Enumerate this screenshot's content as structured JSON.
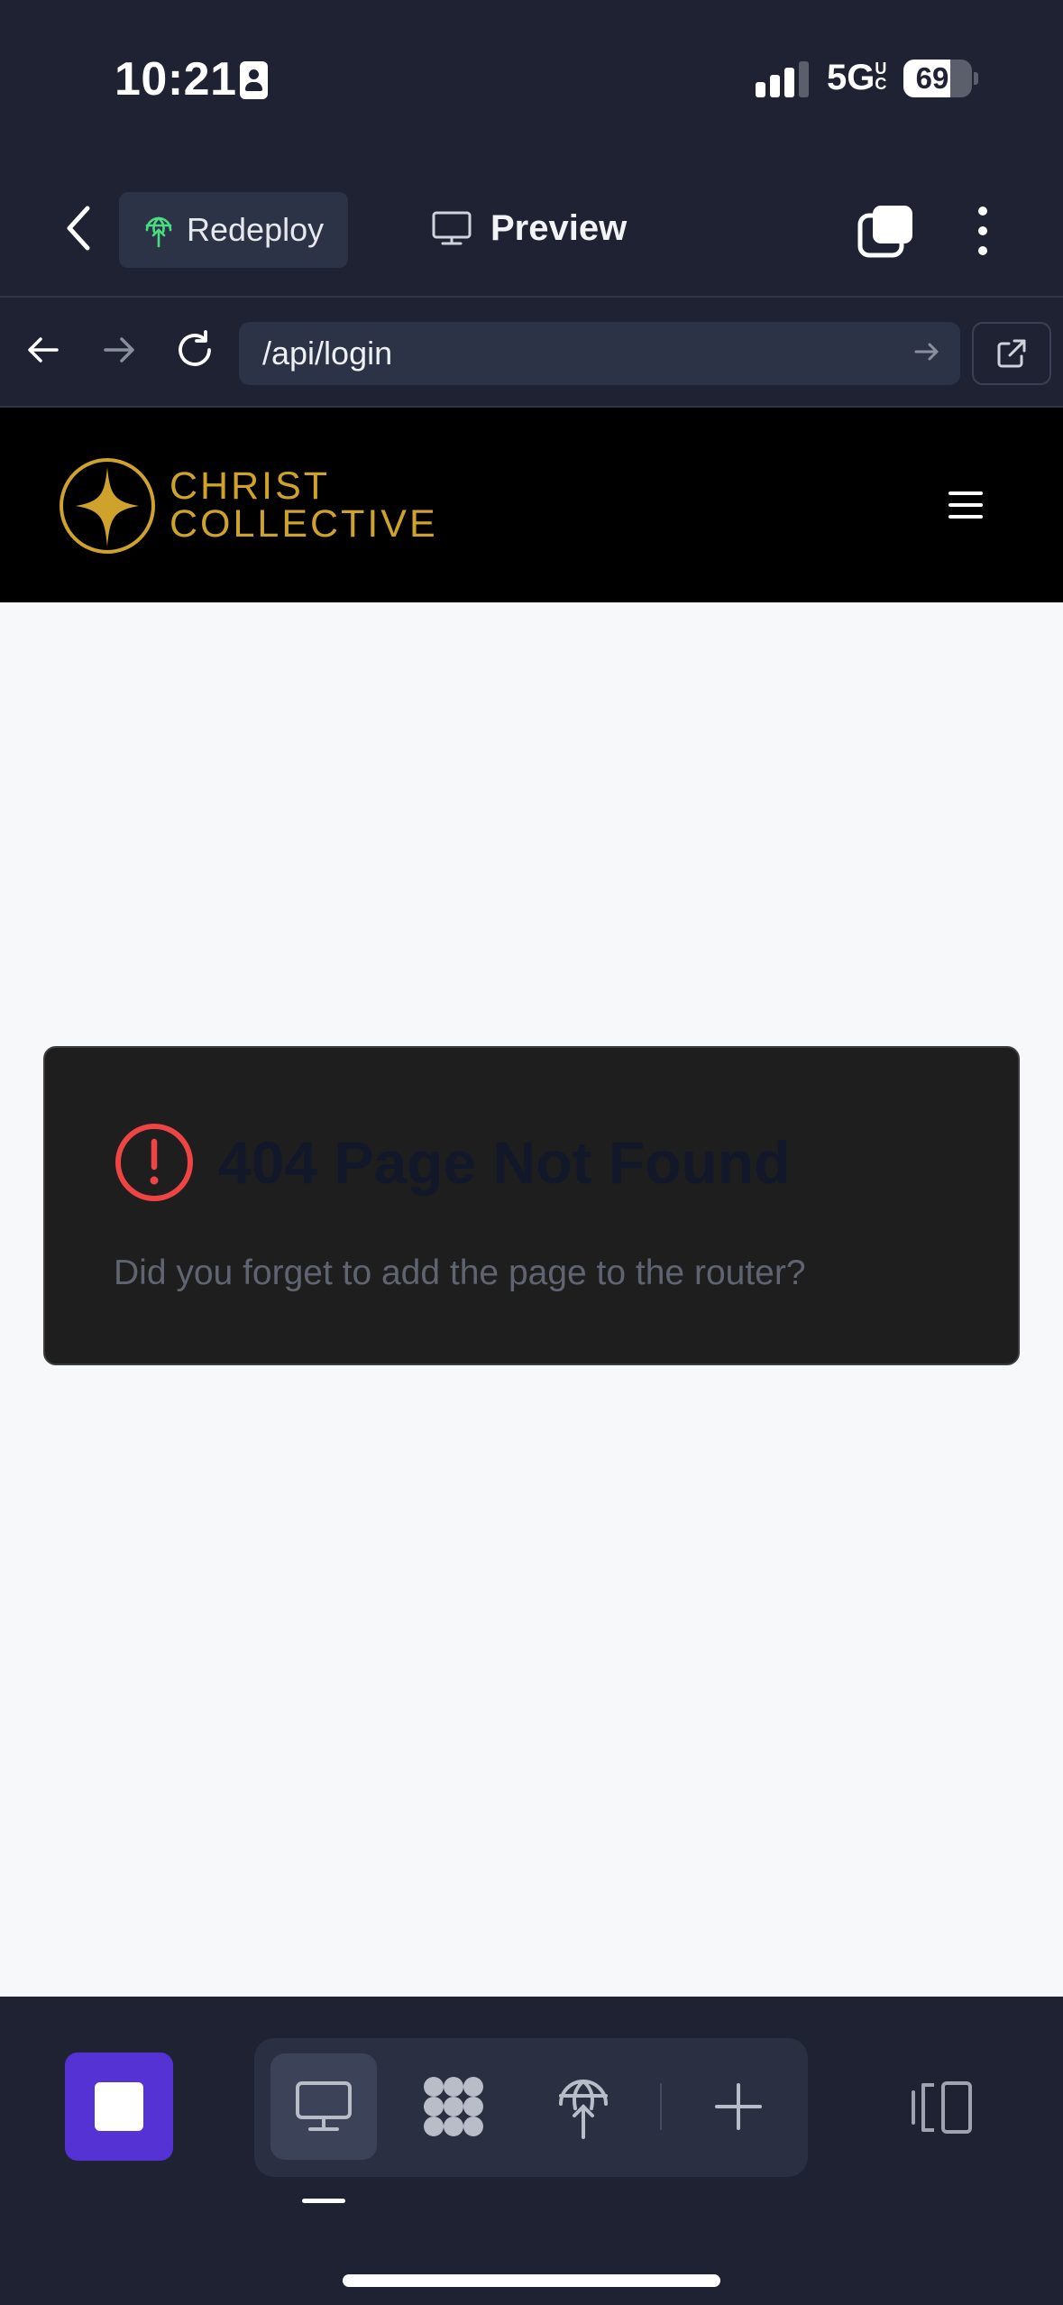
{
  "status_bar": {
    "time": "10:21",
    "network": "5G",
    "network_suffix_top": "U",
    "network_suffix_bottom": "C",
    "battery_percent": 69,
    "battery_text": "69"
  },
  "toolbar": {
    "back_icon": "chevron-left-icon",
    "redeploy_label": "Redeploy",
    "redeploy_icon": "globe-upload-icon",
    "redeploy_icon_color": "#4ade80",
    "preview_label": "Preview",
    "preview_icon": "monitor-icon",
    "tabs_icon": "stacked-squares-icon",
    "more_icon": "vertical-dots-icon"
  },
  "urlbar": {
    "url": "/api/login",
    "back_icon": "arrow-left-icon",
    "forward_icon": "arrow-right-icon",
    "reload_icon": "reload-icon",
    "go_icon": "arrow-right-icon",
    "open_external_icon": "external-link-icon"
  },
  "site": {
    "logo_line1": "CHRIST",
    "logo_line2": "COLLECTIVE",
    "brand_color": "#cfa22b",
    "menu_icon": "hamburger-icon"
  },
  "error_card": {
    "title": "404 Page Not Found",
    "message": "Did you forget to add the page to the router?",
    "icon": "alert-circle-icon",
    "icon_color": "#ef4444"
  },
  "bottom_bar": {
    "stop_icon": "stop-square-icon",
    "accent_color": "#5432d3",
    "tools": [
      {
        "name": "preview",
        "icon": "monitor-icon",
        "active": true
      },
      {
        "name": "workflows",
        "icon": "nodes-icon",
        "active": false
      },
      {
        "name": "deploy",
        "icon": "globe-upload-icon",
        "active": false
      },
      {
        "name": "add",
        "icon": "plus-icon",
        "active": false
      }
    ],
    "panel_icon": "panel-toggle-icon"
  }
}
